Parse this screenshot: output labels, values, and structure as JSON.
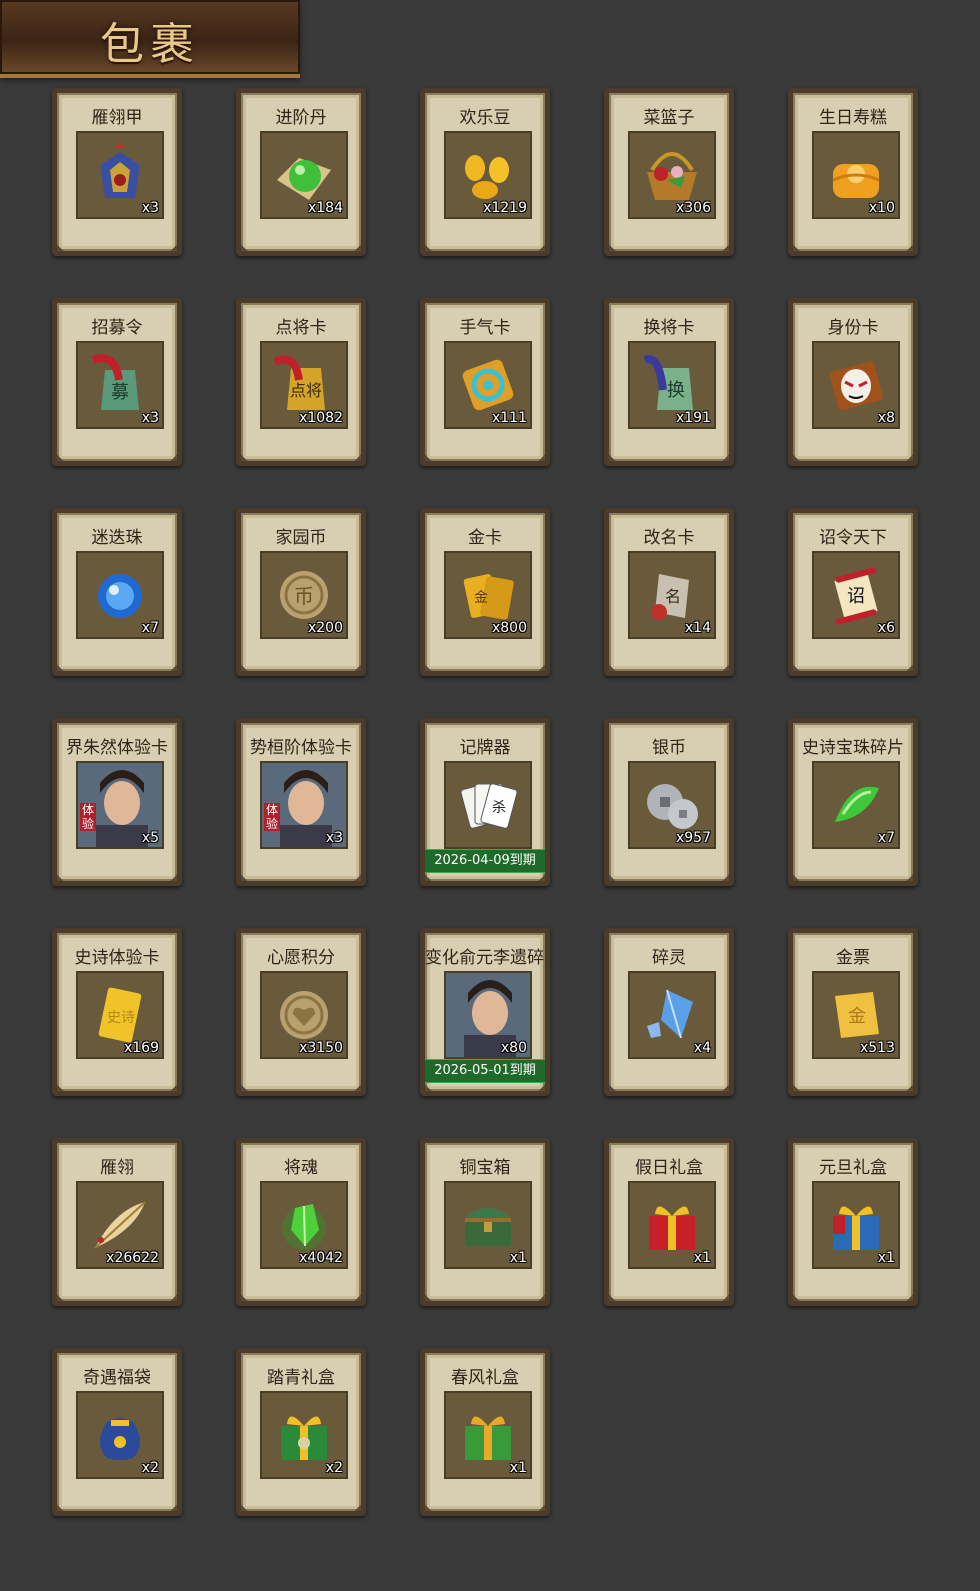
{
  "header": {
    "title": "包裹"
  },
  "items": [
    {
      "name": "雁翎甲",
      "qty": "x3",
      "icon": "armor-icon"
    },
    {
      "name": "进阶丹",
      "qty": "x184",
      "icon": "green-pill-icon"
    },
    {
      "name": "欢乐豆",
      "qty": "x1219",
      "icon": "gold-beans-icon"
    },
    {
      "name": "菜篮子",
      "qty": "x306",
      "icon": "basket-icon"
    },
    {
      "name": "生日寿糕",
      "qty": "x10",
      "icon": "cake-icon"
    },
    {
      "name": "招募令",
      "qty": "x3",
      "icon": "recruit-token-icon"
    },
    {
      "name": "点将卡",
      "qty": "x1082",
      "icon": "general-token-icon"
    },
    {
      "name": "手气卡",
      "qty": "x111",
      "icon": "luck-card-icon"
    },
    {
      "name": "换将卡",
      "qty": "x191",
      "icon": "swap-token-icon"
    },
    {
      "name": "身份卡",
      "qty": "x8",
      "icon": "mask-card-icon"
    },
    {
      "name": "迷迭珠",
      "qty": "x7",
      "icon": "blue-orb-icon"
    },
    {
      "name": "家园币",
      "qty": "x200",
      "icon": "home-coin-icon"
    },
    {
      "name": "金卡",
      "qty": "x800",
      "icon": "gold-card-icon"
    },
    {
      "name": "改名卡",
      "qty": "x14",
      "icon": "rename-tag-icon"
    },
    {
      "name": "诏令天下",
      "qty": "x6",
      "icon": "scroll-icon"
    },
    {
      "name": "界朱然体验卡",
      "qty": "x5",
      "icon": "hero-portrait-icon",
      "badge": "体验"
    },
    {
      "name": "势桓阶体验卡",
      "qty": "x3",
      "icon": "hero-portrait-icon",
      "badge": "体验"
    },
    {
      "name": "记牌器",
      "qty": "",
      "icon": "cards-icon",
      "expiry": "2026-04-09到期"
    },
    {
      "name": "银币",
      "qty": "x957",
      "icon": "silver-coins-icon"
    },
    {
      "name": "史诗宝珠碎片",
      "qty": "x7",
      "icon": "green-shard-icon"
    },
    {
      "name": "史诗体验卡",
      "qty": "x169",
      "icon": "gold-ticket-icon"
    },
    {
      "name": "心愿积分",
      "qty": "x3150",
      "icon": "heart-coin-icon"
    },
    {
      "name": "变化俞元李遗碎片",
      "qty": "x80",
      "icon": "hero-portrait-icon",
      "expiry": "2026-05-01到期"
    },
    {
      "name": "碎灵",
      "qty": "x4",
      "icon": "crystal-icon"
    },
    {
      "name": "金票",
      "qty": "x513",
      "icon": "gold-scroll-icon"
    },
    {
      "name": "雁翎",
      "qty": "x26622",
      "icon": "feather-icon"
    },
    {
      "name": "将魂",
      "qty": "x4042",
      "icon": "soul-gem-icon"
    },
    {
      "name": "铜宝箱",
      "qty": "x1",
      "icon": "chest-icon"
    },
    {
      "name": "假日礼盒",
      "qty": "x1",
      "icon": "red-gift-icon"
    },
    {
      "name": "元旦礼盒",
      "qty": "x1",
      "icon": "blue-gift-icon"
    },
    {
      "name": "奇遇福袋",
      "qty": "x2",
      "icon": "lucky-bag-icon"
    },
    {
      "name": "踏青礼盒",
      "qty": "x2",
      "icon": "green-gift-icon"
    },
    {
      "name": "春风礼盒",
      "qty": "x1",
      "icon": "spring-gift-icon"
    }
  ],
  "colors": {
    "background": "#3a3a3a",
    "card": "#d8ceb2",
    "card_border": "#4a3b2a",
    "expiry_bar": "#1f6a2a",
    "title_text": "#e9c98a"
  }
}
